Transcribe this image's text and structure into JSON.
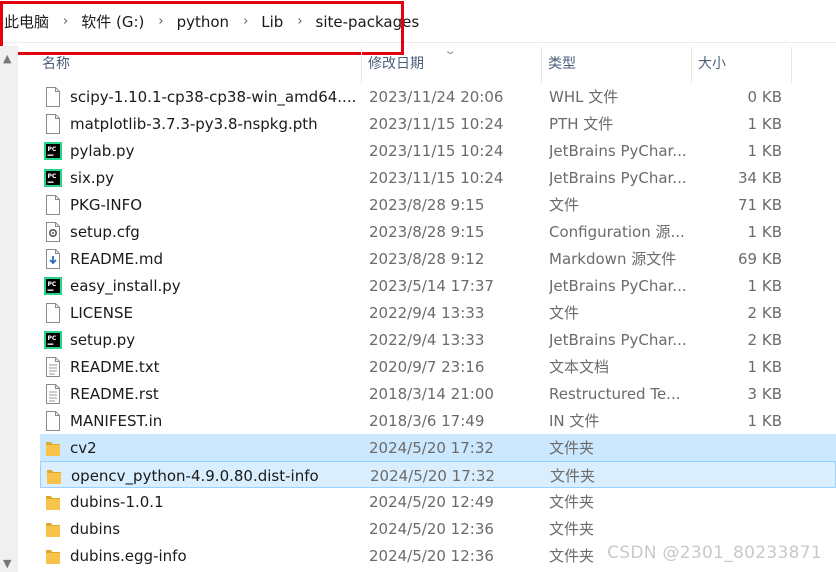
{
  "breadcrumb": {
    "items": [
      "此电脑",
      "软件 (G:)",
      "python",
      "Lib",
      "site-packages"
    ],
    "separator": "›"
  },
  "columns": {
    "name": "名称",
    "date": "修改日期",
    "type": "类型",
    "size": "大小"
  },
  "files": [
    {
      "name": "scipy-1.10.1-cp38-cp38-win_amd64....",
      "date": "2023/11/24 20:06",
      "type": "WHL 文件",
      "size": "0 KB",
      "icon": "file-icon"
    },
    {
      "name": "matplotlib-3.7.3-py3.8-nspkg.pth",
      "date": "2023/11/15 10:24",
      "type": "PTH 文件",
      "size": "1 KB",
      "icon": "file-icon"
    },
    {
      "name": "pylab.py",
      "date": "2023/11/15 10:24",
      "type": "JetBrains PyChar...",
      "size": "1 KB",
      "icon": "pycharm-icon"
    },
    {
      "name": "six.py",
      "date": "2023/11/15 10:24",
      "type": "JetBrains PyChar...",
      "size": "34 KB",
      "icon": "pycharm-icon"
    },
    {
      "name": "PKG-INFO",
      "date": "2023/8/28 9:15",
      "type": "文件",
      "size": "71 KB",
      "icon": "file-icon"
    },
    {
      "name": "setup.cfg",
      "date": "2023/8/28 9:15",
      "type": "Configuration 源...",
      "size": "1 KB",
      "icon": "config-file-icon"
    },
    {
      "name": "README.md",
      "date": "2023/8/28 9:12",
      "type": "Markdown 源文件",
      "size": "69 KB",
      "icon": "markdown-file-icon"
    },
    {
      "name": "easy_install.py",
      "date": "2023/5/14 17:37",
      "type": "JetBrains PyChar...",
      "size": "1 KB",
      "icon": "pycharm-icon"
    },
    {
      "name": "LICENSE",
      "date": "2022/9/4 13:33",
      "type": "文件",
      "size": "2 KB",
      "icon": "file-icon"
    },
    {
      "name": "setup.py",
      "date": "2022/9/4 13:33",
      "type": "JetBrains PyChar...",
      "size": "2 KB",
      "icon": "pycharm-icon"
    },
    {
      "name": "README.txt",
      "date": "2020/9/7 23:16",
      "type": "文本文档",
      "size": "1 KB",
      "icon": "text-file-icon"
    },
    {
      "name": "README.rst",
      "date": "2018/3/14 21:00",
      "type": "Restructured Te...",
      "size": "3 KB",
      "icon": "text-file-icon"
    },
    {
      "name": "MANIFEST.in",
      "date": "2018/3/6 17:49",
      "type": "IN 文件",
      "size": "1 KB",
      "icon": "file-icon"
    },
    {
      "name": "cv2",
      "date": "2024/5/20 17:32",
      "type": "文件夹",
      "size": "",
      "icon": "folder-icon",
      "state": "selected"
    },
    {
      "name": "opencv_python-4.9.0.80.dist-info",
      "date": "2024/5/20 17:32",
      "type": "文件夹",
      "size": "",
      "icon": "folder-icon",
      "state": "selected-focus"
    },
    {
      "name": "dubins-1.0.1",
      "date": "2024/5/20 12:49",
      "type": "文件夹",
      "size": "",
      "icon": "folder-icon"
    },
    {
      "name": "dubins",
      "date": "2024/5/20 12:36",
      "type": "文件夹",
      "size": "",
      "icon": "folder-icon"
    },
    {
      "name": "dubins.egg-info",
      "date": "2024/5/20 12:36",
      "type": "文件夹",
      "size": "",
      "icon": "folder-icon"
    }
  ],
  "watermark": "CSDN @2301_80233871",
  "colors": {
    "selection": "#cce8ff",
    "selection_border": "#99d1ff",
    "highlight_box": "#e3000f",
    "header_text": "#4c607a",
    "folder": "#f7c34a"
  }
}
